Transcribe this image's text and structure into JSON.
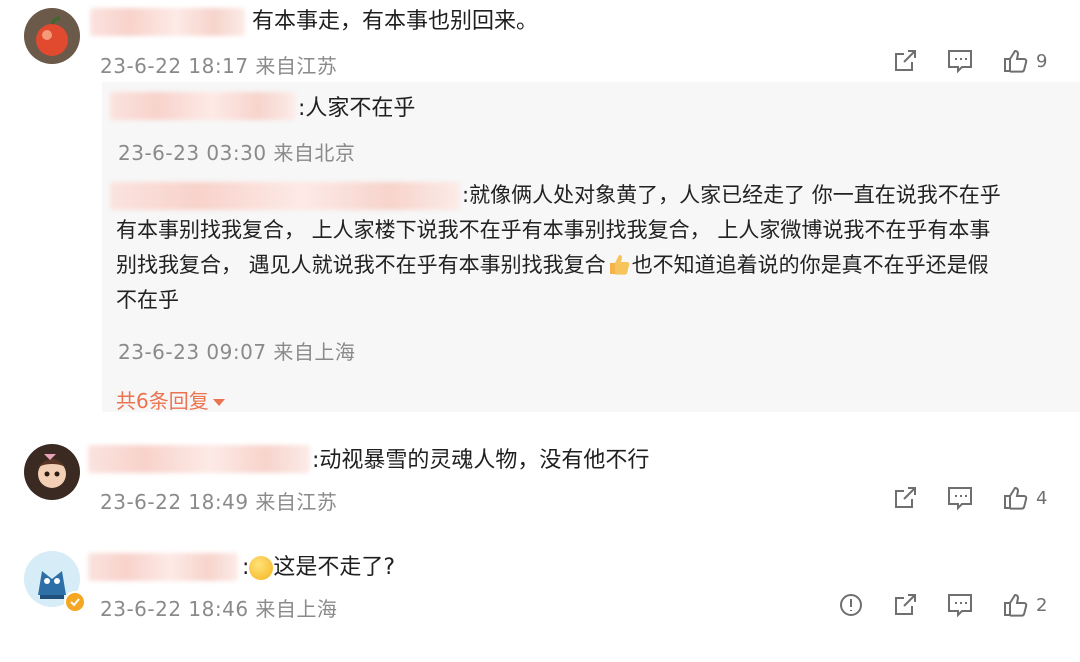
{
  "comments": [
    {
      "text": "有本事走，有本事也别回来。",
      "date": "23-6-22 18:17",
      "location": "来自江苏",
      "likes": "9",
      "replies": [
        {
          "text": ":人家不在乎",
          "date": "23-6-23 03:30",
          "location": "来自北京"
        },
        {
          "line1": ":就像俩人处对象黄了，人家已经走了 你一直在说我不在乎",
          "line2": "有本事别找我复合， 上人家楼下说我不在乎有本事别找我复合， 上人家微博说我不在乎有本事",
          "line3a": "别找我复合， 遇见人就说我不在乎有本事别找我复合",
          "line3b": "也不知道追着说的你是真不在乎还是假",
          "line4": "不在乎",
          "date": "23-6-23 09:07",
          "location": "来自上海"
        }
      ],
      "more_replies": "共6条回复"
    },
    {
      "text": ":动视暴雪的灵魂人物，没有他不行",
      "date": "23-6-22 18:49",
      "location": "来自江苏",
      "likes": "4"
    },
    {
      "text": "这是不走了?",
      "date": "23-6-22 18:46",
      "location": "来自上海",
      "likes": "2"
    }
  ],
  "icons": [
    "share-icon",
    "comment-icon",
    "like-icon",
    "report-icon",
    "thumbs-up-emoji",
    "verified-badge-icon"
  ],
  "colors": {
    "accent": "#eb7350",
    "meta": "#8a8a8a",
    "verified": "#f5a623"
  }
}
